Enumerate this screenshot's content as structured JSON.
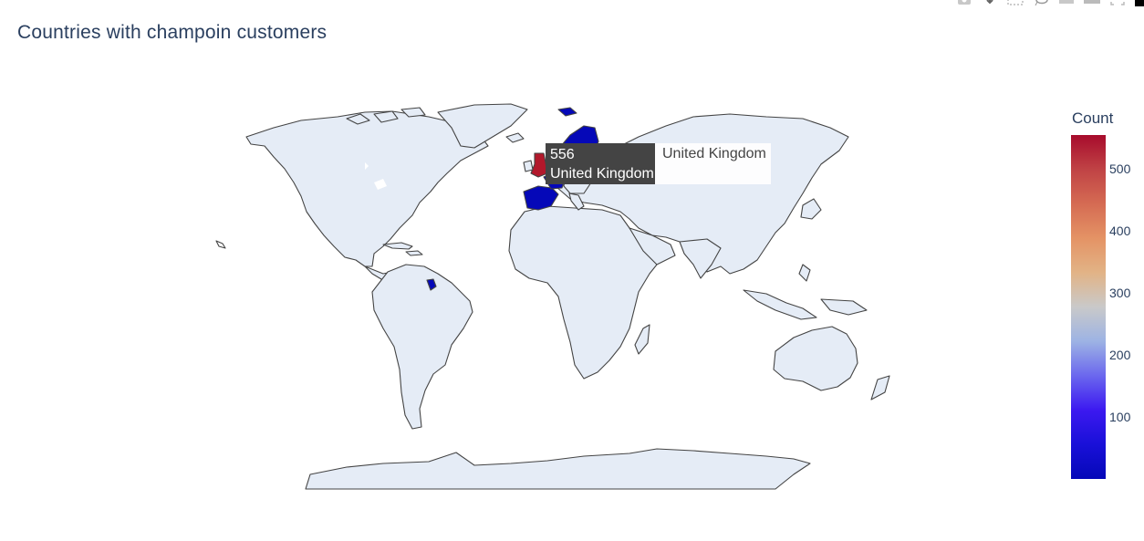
{
  "title": "Countries with champoin customers",
  "modebar": {
    "buttons": [
      "camera-icon",
      "download-icon",
      "box-select-icon",
      "lasso-icon",
      "zoom-in-icon",
      "zoom-out-icon",
      "reset-icon",
      "plotly-logo"
    ]
  },
  "colorbar": {
    "title": "Count",
    "ticks": [
      "500",
      "400",
      "300",
      "200",
      "100"
    ]
  },
  "tooltip": {
    "value": "556",
    "country": "United Kingdom",
    "name_label": "United Kingdom"
  },
  "chart_data": {
    "type": "choropleth",
    "title": "Countries with champoin customers",
    "colorbar_title": "Count",
    "color_range": [
      1,
      556
    ],
    "colorscale": [
      "#0508b8",
      "#6b67ee",
      "#c9c9c9",
      "#e49365",
      "#a70b2c"
    ],
    "land_color": "#e5ecf6",
    "highlighted_countries": [
      {
        "country": "United Kingdom",
        "value": 556
      },
      {
        "country": "France",
        "value": 1
      },
      {
        "country": "Spain",
        "value": 1
      },
      {
        "country": "Norway",
        "value": 1
      },
      {
        "country": "Sweden",
        "value": 1
      },
      {
        "country": "Finland",
        "value": 1
      },
      {
        "country": "French Guiana",
        "value": 1
      }
    ]
  }
}
